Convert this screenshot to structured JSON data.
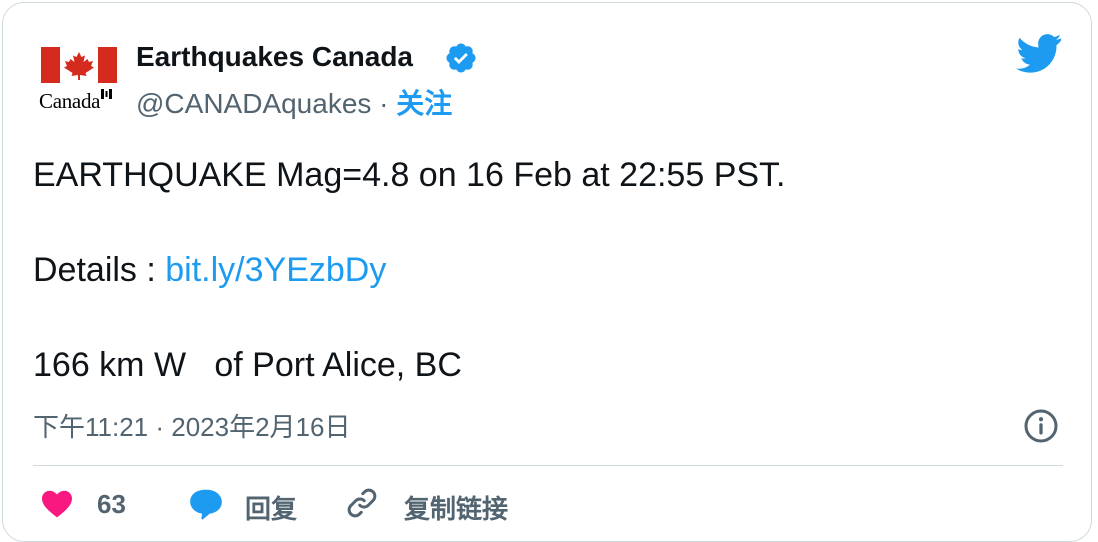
{
  "author": {
    "display_name": "Earthquakes Canada",
    "handle": "@CANADAquakes",
    "separator": " · ",
    "follow_label": "关注",
    "avatar_wordmark": "Canada",
    "verified": true,
    "verified_badge_icon": "verified-badge-icon",
    "logo_icon": "canada-flag-logo"
  },
  "tweet": {
    "line1": "EARTHQUAKE Mag=4.8 on 16 Feb at 22:55 PST.",
    "details_label": "Details : ",
    "details_link": "bit.ly/3YEzbDy",
    "line3": "166 km W   of Port Alice, BC"
  },
  "meta": {
    "timestamp": "下午11:21 · 2023年2月16日",
    "info_icon": "info-icon",
    "platform_icon": "twitter-bird-icon"
  },
  "actions": {
    "like_count": "63",
    "reply_label": "回复",
    "copy_link_label": "复制链接",
    "like_icon": "heart-icon",
    "reply_icon": "speech-bubble-icon",
    "copy_icon": "link-icon"
  },
  "colors": {
    "accent": "#1d9bf0",
    "text": "#0f1419",
    "secondary": "#536471",
    "like": "#f91880",
    "flag_red": "#d52b1e",
    "border": "#cfd9de"
  }
}
